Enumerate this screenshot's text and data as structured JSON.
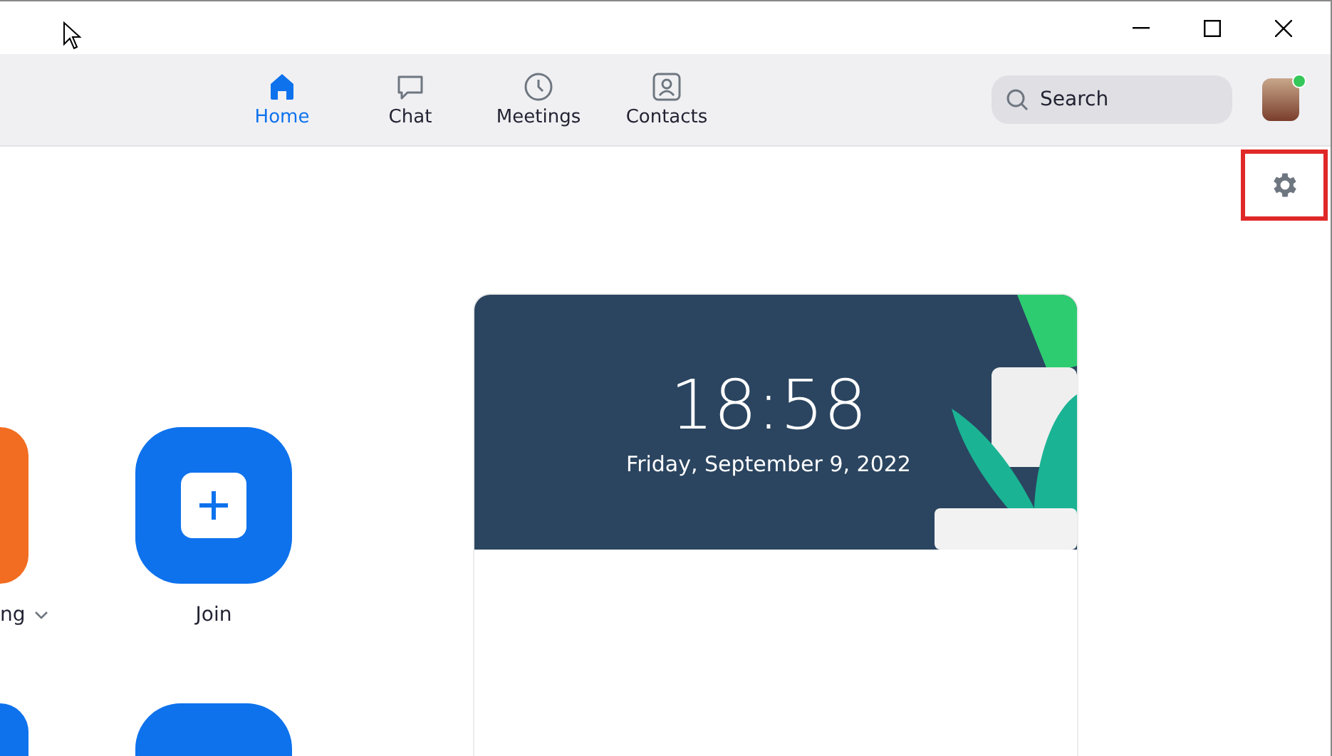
{
  "nav": {
    "tabs": [
      {
        "label": "Home",
        "selected": true
      },
      {
        "label": "Chat",
        "selected": false
      },
      {
        "label": "Meetings",
        "selected": false
      },
      {
        "label": "Contacts",
        "selected": false
      }
    ],
    "search": {
      "placeholder": "Search"
    },
    "profile": {
      "online": true
    }
  },
  "actions": [
    {
      "label": "ng",
      "color": "#f26d21",
      "dropdown": true
    },
    {
      "label": "Join",
      "color": "#0e72ed"
    },
    {
      "color": "#0e72ed"
    },
    {
      "color": "#0e72ed"
    }
  ],
  "clock": {
    "time": "18:58",
    "date": "Friday, September 9, 2022"
  }
}
